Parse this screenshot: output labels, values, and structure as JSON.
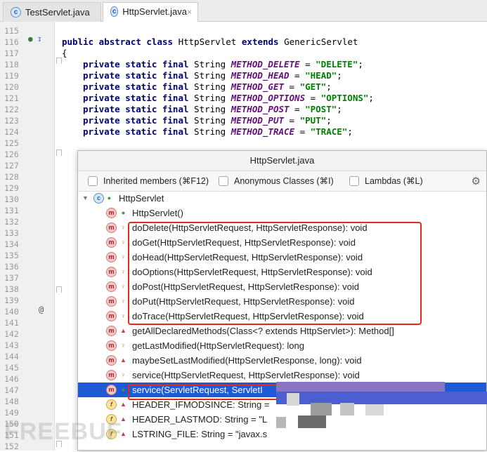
{
  "tabs": [
    {
      "label": "TestServlet.java",
      "icon": "class-icon",
      "active": false
    },
    {
      "label": "HttpServlet.java",
      "icon": "class-icon",
      "active": true
    }
  ],
  "tab_close_glyph": "×",
  "class_icon_glyph": "c",
  "code": {
    "lines": [
      {
        "num": "115",
        "text": ""
      },
      {
        "num": "116",
        "kw": "public abstract class ",
        "rest": "HttpServlet ",
        "kw2": "extends ",
        "rest2": "GenericServlet"
      },
      {
        "num": "117",
        "text": "{"
      },
      {
        "num": "118",
        "field": "METHOD_DELETE",
        "value": "\"DELETE\""
      },
      {
        "num": "119",
        "field": "METHOD_HEAD",
        "value": "\"HEAD\""
      },
      {
        "num": "120",
        "field": "METHOD_GET",
        "value": "\"GET\""
      },
      {
        "num": "121",
        "field": "METHOD_OPTIONS",
        "value": "\"OPTIONS\""
      },
      {
        "num": "122",
        "field": "METHOD_POST",
        "value": "\"POST\""
      },
      {
        "num": "123",
        "field": "METHOD_PUT",
        "value": "\"PUT\""
      },
      {
        "num": "124",
        "field": "METHOD_TRACE",
        "value": "\"TRACE\""
      },
      {
        "num": "125",
        "text": ""
      },
      {
        "num": "126",
        "text": ""
      },
      {
        "num": "127",
        "text": ""
      },
      {
        "num": "128",
        "text": ""
      },
      {
        "num": "129",
        "text": ""
      },
      {
        "num": "130",
        "text": ""
      },
      {
        "num": "131",
        "text": ""
      },
      {
        "num": "132",
        "text": ""
      },
      {
        "num": "133",
        "text": ""
      },
      {
        "num": "134",
        "text": ""
      },
      {
        "num": "135",
        "text": ""
      },
      {
        "num": "136",
        "text": ""
      },
      {
        "num": "137",
        "text": ""
      },
      {
        "num": "138",
        "text": ""
      },
      {
        "num": "139",
        "text": ""
      },
      {
        "num": "140",
        "text": ""
      },
      {
        "num": "141",
        "text": ""
      },
      {
        "num": "142",
        "text": ""
      },
      {
        "num": "143",
        "text": ""
      },
      {
        "num": "144",
        "text": ""
      },
      {
        "num": "145",
        "text": ""
      },
      {
        "num": "146",
        "text": ""
      },
      {
        "num": "147",
        "text": ""
      },
      {
        "num": "148",
        "text": ""
      },
      {
        "num": "149",
        "text": ""
      },
      {
        "num": "150",
        "text": ""
      },
      {
        "num": "151",
        "text": ""
      },
      {
        "num": "152",
        "text": ""
      }
    ],
    "field_prefix": "private static final ",
    "field_type": "String ",
    "assign": " = ",
    "semicolon": ";",
    "line_140_annotation": "@"
  },
  "popup": {
    "title": "HttpServlet.java",
    "filters": [
      {
        "label": "Inherited members (⌘F12)",
        "checked": false
      },
      {
        "label": "Anonymous Classes (⌘I)",
        "checked": false
      },
      {
        "label": "Lambdas (⌘L)",
        "checked": false
      }
    ],
    "settings_icon": "gear-icon",
    "settings_glyph": "⚙",
    "tree_root": {
      "label": "HttpServlet",
      "expanded": true,
      "expand_glyph": "▼",
      "icon_glyph": "c",
      "access_glyph": "●"
    },
    "method_icon_glyph": "m",
    "field_icon_glyph": "f",
    "access_glyphs": {
      "public": "●",
      "protected": "♀",
      "private": "▲"
    },
    "members": [
      {
        "kind": "method",
        "access": "public",
        "label": "HttpServlet()"
      },
      {
        "kind": "method",
        "access": "protected",
        "label": "doDelete(HttpServletRequest, HttpServletResponse): void"
      },
      {
        "kind": "method",
        "access": "protected",
        "label": "doGet(HttpServletRequest, HttpServletResponse): void"
      },
      {
        "kind": "method",
        "access": "protected",
        "label": "doHead(HttpServletRequest, HttpServletResponse): void"
      },
      {
        "kind": "method",
        "access": "protected",
        "label": "doOptions(HttpServletRequest, HttpServletResponse): void"
      },
      {
        "kind": "method",
        "access": "protected",
        "label": "doPost(HttpServletRequest, HttpServletResponse): void"
      },
      {
        "kind": "method",
        "access": "protected",
        "label": "doPut(HttpServletRequest, HttpServletResponse): void"
      },
      {
        "kind": "method",
        "access": "protected",
        "label": "doTrace(HttpServletRequest, HttpServletResponse): void"
      },
      {
        "kind": "method",
        "access": "private",
        "label": "getAllDeclaredMethods(Class<? extends HttpServlet>): Method[]"
      },
      {
        "kind": "method",
        "access": "protected",
        "label": "getLastModified(HttpServletRequest): long"
      },
      {
        "kind": "method",
        "access": "private",
        "label": "maybeSetLastModified(HttpServletResponse, long): void"
      },
      {
        "kind": "method",
        "access": "protected",
        "label": "service(HttpServletRequest, HttpServletResponse): void"
      },
      {
        "kind": "method",
        "access": "public",
        "label": "service(ServletRequest, ServletI",
        "selected": true
      },
      {
        "kind": "field",
        "access": "private",
        "label": "HEADER_IFMODSINCE: String = "
      },
      {
        "kind": "field",
        "access": "private",
        "label": "HEADER_LASTMOD: String = \"L"
      },
      {
        "kind": "field",
        "access": "private",
        "label": "LSTRING_FILE: String = \"javax.s"
      }
    ]
  },
  "watermark": "FREEBUF",
  "colors": {
    "highlight_box": "#e02a1c",
    "selection": "#1f59d6"
  }
}
